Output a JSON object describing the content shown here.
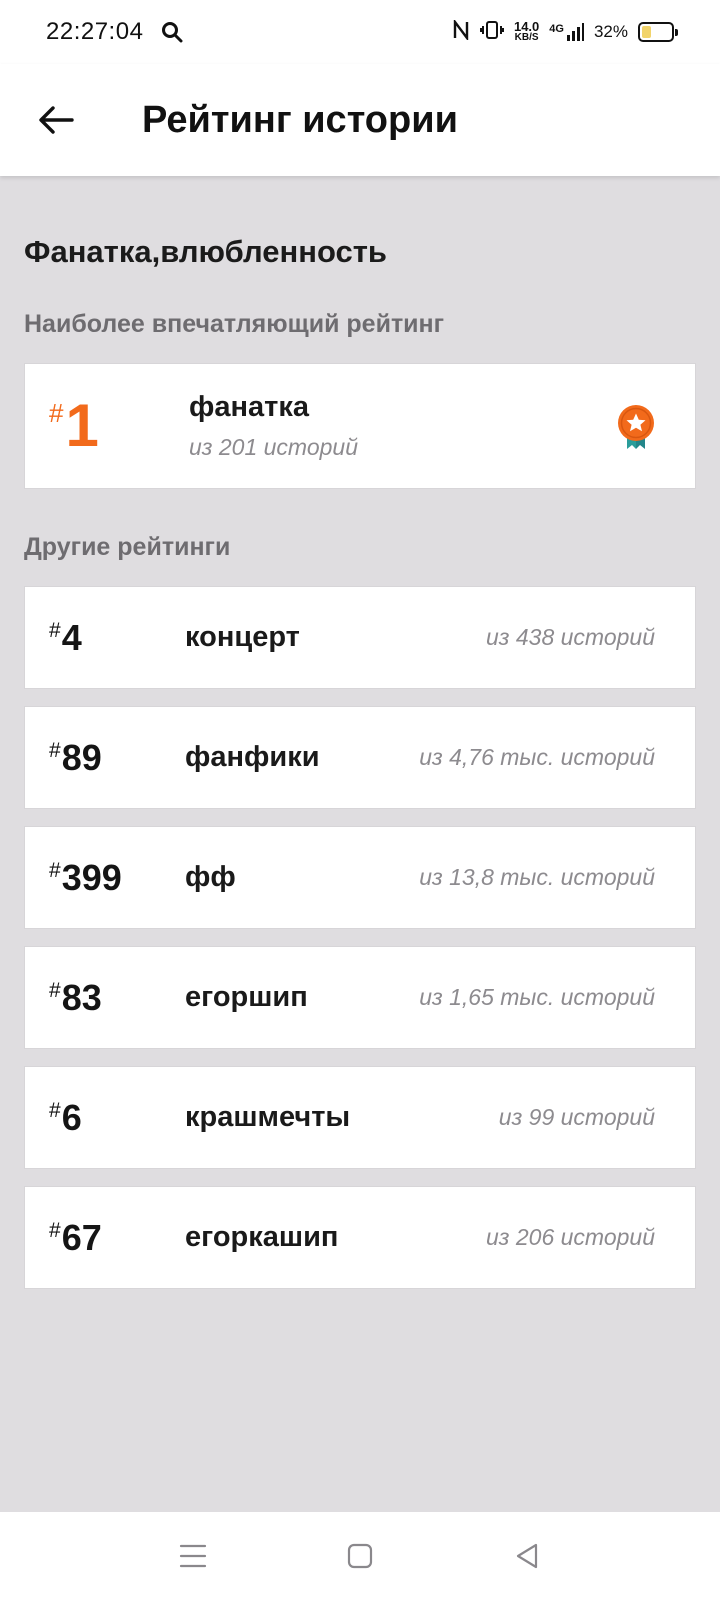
{
  "status_bar": {
    "time": "22:27:04",
    "net_speed_value": "14.0",
    "net_speed_unit": "KB/S",
    "network_type": "4G",
    "battery_percent": "32%",
    "battery_level": 0.32,
    "icons": [
      "search-icon",
      "nfc-icon",
      "vibrate-icon",
      "signal-icon",
      "battery-icon"
    ]
  },
  "header": {
    "back_icon": "arrow-left-icon",
    "title": "Рейтинг истории"
  },
  "category": {
    "title": "Фанатка,влюбленность"
  },
  "top_section": {
    "label": "Наиболее впечатляющий рейтинг",
    "rank_hash": "#",
    "rank": "1",
    "tag": "фанатка",
    "count": "из 201 историй",
    "badge_icon": "medal-star-icon",
    "accent_color": "#f26a1b"
  },
  "other_section": {
    "label": "Другие рейтинги",
    "items": [
      {
        "hash": "#",
        "rank": "4",
        "tag": "концерт",
        "count": "из 438 историй"
      },
      {
        "hash": "#",
        "rank": "89",
        "tag": "фанфики",
        "count": "из 4,76 тыс. историй"
      },
      {
        "hash": "#",
        "rank": "399",
        "tag": "фф",
        "count": "из 13,8 тыс. историй"
      },
      {
        "hash": "#",
        "rank": "83",
        "tag": "егоршип",
        "count": "из 1,65 тыс. историй"
      },
      {
        "hash": "#",
        "rank": "6",
        "tag": "крашмечты",
        "count": "из 99 историй"
      },
      {
        "hash": "#",
        "rank": "67",
        "tag": "егоркашип",
        "count": "из 206 историй"
      }
    ]
  },
  "nav_bar": {
    "icons": [
      "menu-icon",
      "home-square-icon",
      "back-triangle-icon"
    ]
  }
}
